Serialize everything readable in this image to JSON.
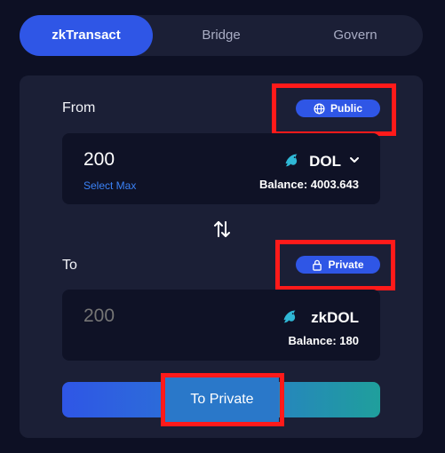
{
  "tabs": [
    {
      "label": "zkTransact",
      "active": true
    },
    {
      "label": "Bridge",
      "active": false
    },
    {
      "label": "Govern",
      "active": false
    }
  ],
  "from": {
    "label": "From",
    "mode_badge": "Public",
    "amount": "200",
    "select_max": "Select Max",
    "token": "DOL",
    "balance": "Balance: 4003.643"
  },
  "to": {
    "label": "To",
    "mode_badge": "Private",
    "amount_placeholder": "200",
    "token": "zkDOL",
    "balance": "Balance: 180"
  },
  "action_button": "To Private",
  "colors": {
    "background": "#0d1024",
    "card": "#1b1f36",
    "accent": "#2f56e6",
    "link": "#3b82f6",
    "highlight": "#ff1a1a"
  },
  "icons": [
    "globe-icon",
    "lock-icon",
    "dolphin-token-icon",
    "chevron-down-icon",
    "swap-arrows-icon"
  ]
}
